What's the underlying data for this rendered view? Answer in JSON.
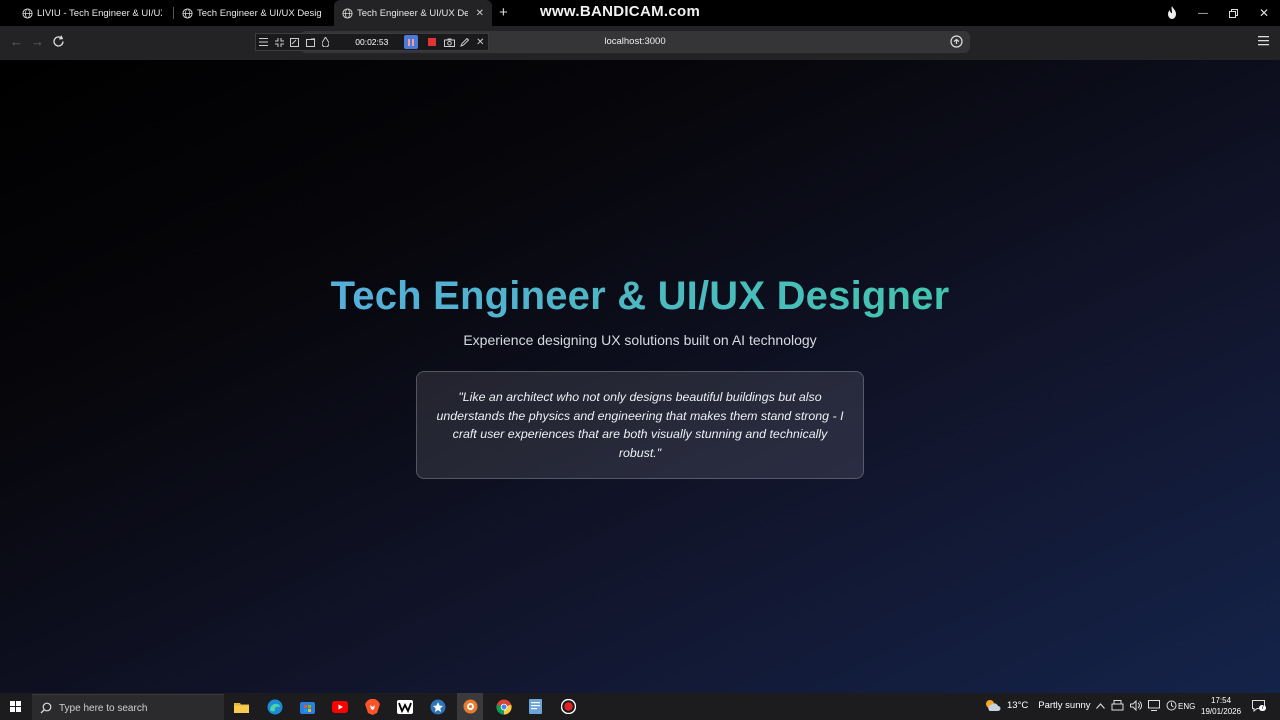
{
  "browser": {
    "tabs": [
      {
        "title": "LIVIU - Tech Engineer & UI/UX De",
        "active": false
      },
      {
        "title": "Tech Engineer & UI/UX Designer",
        "active": false
      },
      {
        "title": "Tech Engineer & UI/UX Desig",
        "active": true
      }
    ],
    "new_tab_glyph": "+",
    "watermark": "www.BANDICAM.com",
    "url": "localhost:3000"
  },
  "recorder": {
    "elapsed": "00:02:53"
  },
  "page": {
    "title": "Tech Engineer & UI/UX Designer",
    "subtitle": "Experience designing UX solutions built on AI technology",
    "quote": "\"Like an architect who not only designs beautiful buildings but also understands the physics and engineering that makes them stand strong - I craft user experiences that are both visually stunning and technically robust.\"",
    "gradient_colors": [
      "#60a5fa",
      "#34d399"
    ]
  },
  "taskbar": {
    "search_placeholder": "Type here to search",
    "weather_temp": "13°C",
    "weather_condition": "Partly sunny",
    "language": "ENG",
    "time": "17:54",
    "date": "19/01/2026",
    "notification_count": "7",
    "apps": [
      "file-explorer-icon",
      "edge-icon",
      "store-icon",
      "youtube-icon",
      "brave-icon",
      "capcut-icon",
      "kodi-icon",
      "bandicam-icon",
      "chrome-icon",
      "notepad-icon",
      "record-icon"
    ]
  }
}
